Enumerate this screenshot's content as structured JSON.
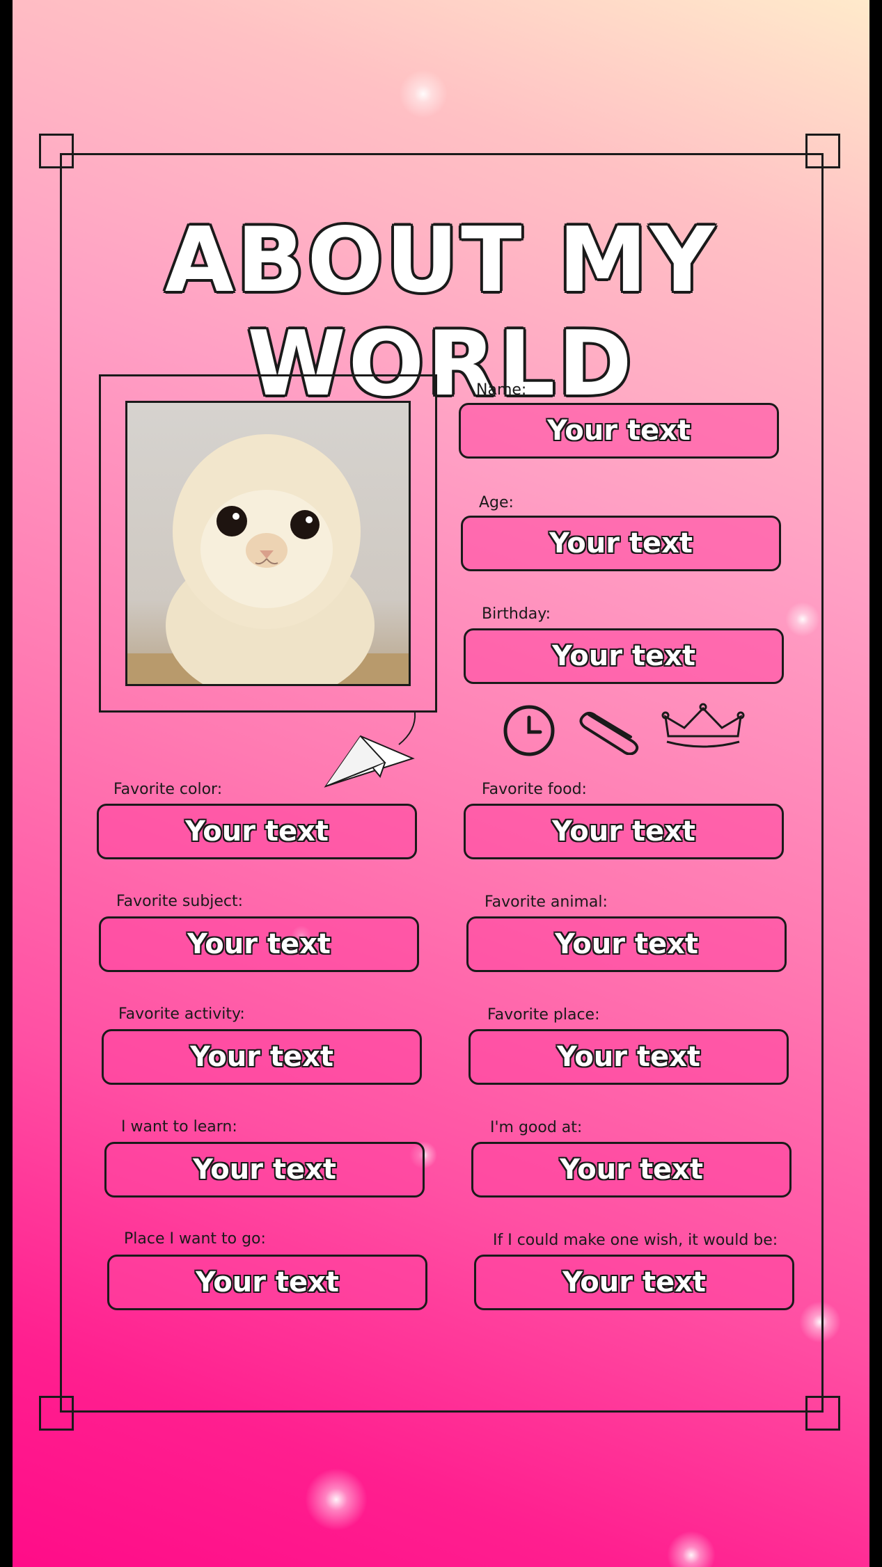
{
  "title": "ABOUT MY WORLD",
  "photo": {
    "subject": "cat-photo"
  },
  "placeholder": "Your text",
  "fields": [
    {
      "label": "Name:",
      "value": "Your text"
    },
    {
      "label": "Age:",
      "value": "Your text"
    },
    {
      "label": "Birthday:",
      "value": "Your text"
    },
    {
      "label": "Favorite color:",
      "value": "Your text"
    },
    {
      "label": "Favorite food:",
      "value": "Your text"
    },
    {
      "label": "Favorite subject:",
      "value": "Your text"
    },
    {
      "label": "Favorite animal:",
      "value": "Your text"
    },
    {
      "label": "Favorite activity:",
      "value": "Your text"
    },
    {
      "label": "Favorite place:",
      "value": "Your text"
    },
    {
      "label": "I want to learn:",
      "value": "Your text"
    },
    {
      "label": "I'm good at:",
      "value": "Your text"
    },
    {
      "label": "Place I want to go:",
      "value": "Your text"
    },
    {
      "label": "If I could make one wish, it would be:",
      "value": "Your text"
    }
  ],
  "decorations": [
    "clock-icon",
    "paperclip-icon",
    "crown-icon",
    "paper-plane-icon"
  ],
  "colors": {
    "background_top": "#ffeacb",
    "background_bottom": "#ff0c88",
    "line": "#1a1a1a",
    "field_fill": "#ff46a0"
  }
}
